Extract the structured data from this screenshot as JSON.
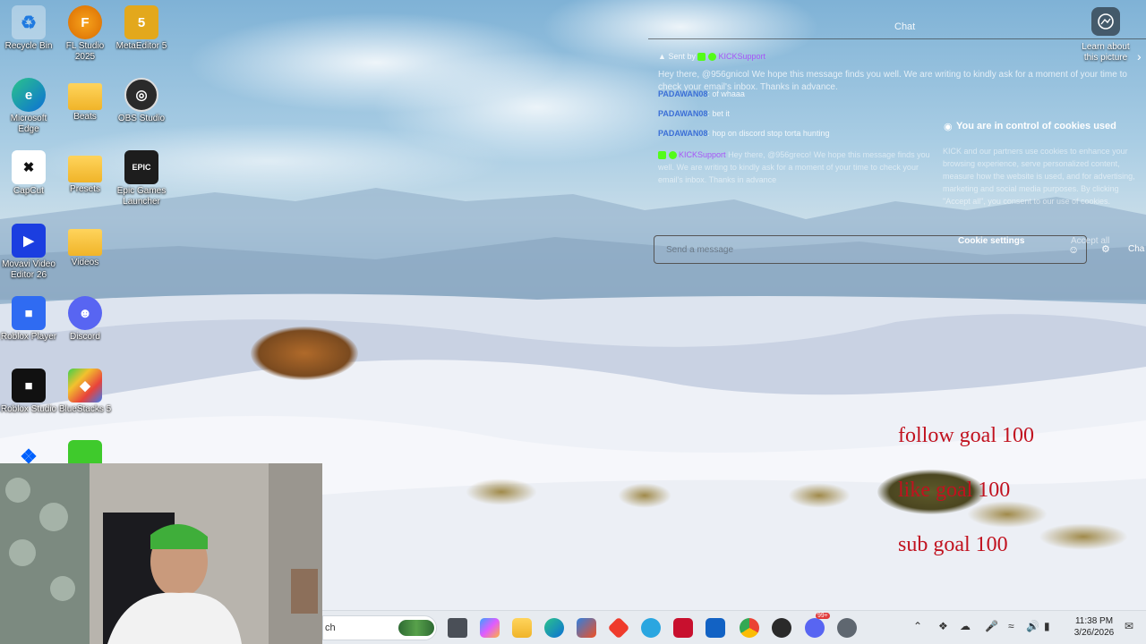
{
  "desktop": {
    "icons": [
      {
        "label": "Recycle Bin",
        "icon": "recycle-bin-icon"
      },
      {
        "label": "FL Studio 2025",
        "icon": "fl-studio-icon"
      },
      {
        "label": "MetaEditor 5",
        "icon": "metaeditor-icon"
      },
      {
        "label": "Microsoft Edge",
        "icon": "edge-icon"
      },
      {
        "label": "Beats",
        "icon": "folder-icon"
      },
      {
        "label": "OBS Studio",
        "icon": "obs-icon"
      },
      {
        "label": "CapCut",
        "icon": "capcut-icon"
      },
      {
        "label": "Presets",
        "icon": "folder-icon"
      },
      {
        "label": "Epic Games Launcher",
        "icon": "epic-games-icon"
      },
      {
        "label": "Movavi Video Editor 26",
        "icon": "movavi-icon"
      },
      {
        "label": "Videos",
        "icon": "folder-icon"
      },
      {
        "label": "Roblox Player",
        "icon": "roblox-icon"
      },
      {
        "label": "Discord",
        "icon": "discord-icon"
      },
      {
        "label": "Roblox Studio",
        "icon": "roblox-studio-icon"
      },
      {
        "label": "BlueStacks 5",
        "icon": "bluestacks-icon"
      }
    ]
  },
  "chat": {
    "title": "Chat",
    "pinned_label": "Sent by",
    "pinned_user": "KICKSupport",
    "pinned_text": "Hey there, @956gnicol We hope this message finds you well. We are writing to kindly ask for a moment of your time to check your email's inbox. Thanks in advance.",
    "messages": [
      {
        "user": "PADAWAN08",
        "text": ": of whaaa"
      },
      {
        "user": "PADAWAN08",
        "text": ": bet it"
      },
      {
        "user": "PADAWAN08",
        "text": ": hop on discord stop torta hunting"
      },
      {
        "user": "KICKSupport",
        "text": "Hey there, @956greco! We hope this message finds you well. We are writing to kindly ask for a moment of your time to check your email's inbox. Thanks in advance"
      }
    ],
    "input_placeholder": "Send a message",
    "chat_button": "Cha"
  },
  "cookie": {
    "title": "You are in control of cookies used",
    "body": "KICK and our partners use cookies to enhance your browsing experience, serve personalized content, measure how the website is used, and for advertising, marketing and social media purposes. By clicking \"Accept all\", you consent to our use of cookies.",
    "settings_label": "Cookie settings",
    "accept_label": "Accept all"
  },
  "learn_about": {
    "label": "Learn about this picture"
  },
  "goals": [
    "follow goal 100",
    "like goal 100",
    "sub goal 100"
  ],
  "taskbar": {
    "search_value": "ch",
    "time": "11:38 PM",
    "date": "3/26/2026",
    "discord_badge": "99+"
  },
  "colors": {
    "kick_green": "#53fc18",
    "goal_red": "#c1121f",
    "taskbar_bg": "#e7ebf0"
  }
}
